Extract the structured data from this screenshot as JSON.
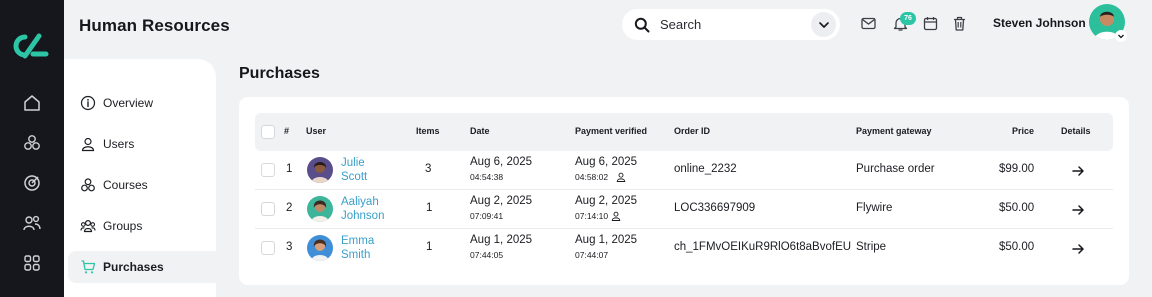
{
  "app": {
    "title": "Human Resources"
  },
  "search": {
    "placeholder": "Search"
  },
  "notifications": {
    "count": "76"
  },
  "user": {
    "name": "Steven Johnson"
  },
  "sidebar": {
    "items": [
      {
        "label": "Overview",
        "icon": "info-icon"
      },
      {
        "label": "Users",
        "icon": "user-icon"
      },
      {
        "label": "Courses",
        "icon": "courses-icon"
      },
      {
        "label": "Groups",
        "icon": "groups-icon"
      },
      {
        "label": "Purchases",
        "icon": "cart-icon",
        "active": true
      }
    ]
  },
  "page": {
    "title": "Purchases"
  },
  "table": {
    "columns": {
      "index": "#",
      "user": "User",
      "items": "Items",
      "date": "Date",
      "payment_verified": "Payment verified",
      "order_id": "Order ID",
      "gateway": "Payment gateway",
      "price": "Price",
      "details": "Details"
    },
    "rows": [
      {
        "index": "1",
        "first": "Julie",
        "last": "Scott",
        "items": "3",
        "date": "Aug 6, 2025",
        "time": "04:54:38",
        "verified_date": "Aug 6, 2025",
        "verified_time": "04:58:02",
        "order_id": "online_2232",
        "gateway": "Purchase order",
        "price": "$99.00"
      },
      {
        "index": "2",
        "first": "Aaliyah",
        "last": "Johnson",
        "items": "1",
        "date": "Aug 2, 2025",
        "time": "07:09:41",
        "verified_date": "Aug 2, 2025",
        "verified_time": "07:14:10",
        "order_id": "LOC336697909",
        "gateway": "Flywire",
        "price": "$50.00"
      },
      {
        "index": "3",
        "first": "Emma",
        "last": "Smith",
        "items": "1",
        "date": "Aug 1, 2025",
        "time": "07:44:05",
        "verified_date": "Aug 1, 2025",
        "verified_time": "07:44:07",
        "order_id": "ch_1FMvOEIKuR9RlO6t8aBvofEU",
        "gateway": "Stripe",
        "price": "$50.00"
      }
    ]
  },
  "colors": {
    "rail": "#15171c",
    "accent": "#2cc5a6",
    "link": "#3a9fc9",
    "background": "#f1f2f4"
  }
}
